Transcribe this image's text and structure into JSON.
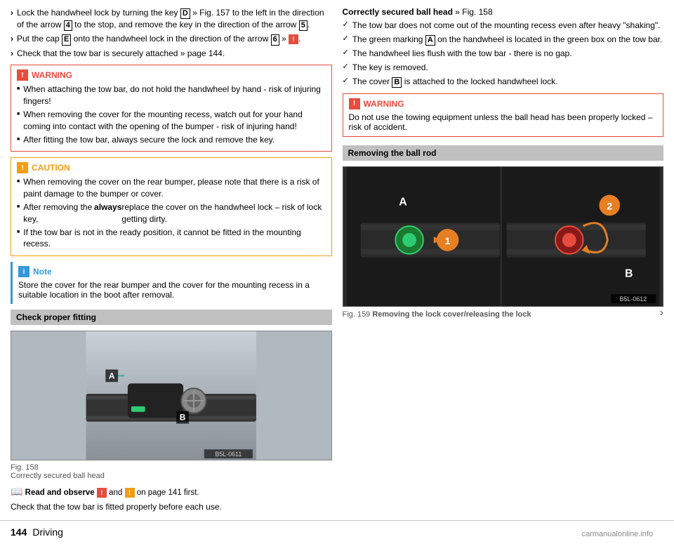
{
  "page": {
    "number": "144",
    "section": "Driving"
  },
  "left_column": {
    "intro_items": [
      {
        "id": "item1",
        "text": "Lock the handwheel lock by turning the key ",
        "key": "D",
        "mid_text": " » Fig. 157 to the left in the direction of the arrow ",
        "box2": "4",
        "end_text": " to the stop, and remove the key in the direction of the arrow ",
        "box3": "5",
        "final": "."
      },
      {
        "id": "item2",
        "text": "Put the cap ",
        "box": "E",
        "mid_text": " onto the handwheel lock in the direction of the arrow ",
        "box2": "6",
        "end_text": " » ",
        "icon": "!",
        "final": "."
      },
      {
        "id": "item3",
        "text": "Check that the tow bar is securely attached » page 144."
      }
    ],
    "warning": {
      "title": "WARNING",
      "items": [
        "When attaching the tow bar, do not hold the handwheel by hand - risk of injuring fingers!",
        "When removing the cover for the mounting recess, watch out for your hand coming into contact with the opening of the bumper - risk of injuring hand!",
        "After fitting the tow bar, always secure the lock and remove the key."
      ]
    },
    "caution": {
      "title": "CAUTION",
      "items": [
        "When removing the cover on the rear bumper, please note that there is a risk of paint damage to the bumper or cover.",
        "After removing the key, always replace the cover on the handwheel lock – risk of lock getting dirty.",
        "If the tow bar is not in the ready position, it cannot be fitted in the mounting recess."
      ]
    },
    "note": {
      "title": "Note",
      "text": "Store the cover for the rear bumper and the cover for the mounting recess in a suitable location in the boot after removal."
    },
    "check_section": {
      "header": "Check proper fitting",
      "figure": {
        "num": "Fig. 158",
        "caption": "Correctly secured ball head",
        "id": "B5L-0611",
        "label_a": "A",
        "label_b": "B"
      },
      "read_observe": "Read and observe",
      "warning_ref": "!",
      "caution_ref": "!",
      "page_ref": "on page 141 first.",
      "body_text": "Check that the tow bar is fitted properly before each use."
    }
  },
  "right_column": {
    "ball_head_section": {
      "title": "Correctly secured ball head",
      "fig_ref": "» Fig. 158",
      "check_items": [
        "The tow bar does not come out of the mounting recess even after heavy \"shaking\".",
        "The green marking ",
        "A",
        " on the handwheel is located in the green box on the tow bar.",
        "The handwheel lies flush with the tow bar - there is no gap.",
        "The key is removed.",
        "The cover "
      ],
      "items": [
        {
          "text": "The tow bar does not come out of the mounting recess even after heavy \"shaking\"."
        },
        {
          "text_parts": [
            "The green marking ",
            "A",
            " on the handwheel is located in the green box on the tow bar."
          ],
          "has_box": true,
          "box_pos": 1
        },
        {
          "text": "The handwheel lies flush with the tow bar - there is no gap."
        },
        {
          "text": "The key is removed."
        },
        {
          "text_parts": [
            "The cover ",
            "B",
            " is attached to the locked handwheel lock."
          ],
          "has_box": true,
          "box_pos": 1
        }
      ]
    },
    "warning2": {
      "title": "WARNING",
      "text": "Do not use the towing equipment unless the ball head has been properly locked – risk of accident."
    },
    "removing_section": {
      "header": "Removing the ball rod",
      "figure": {
        "caption": "Fig. 159",
        "caption_text": "Removing the lock cover/releasing the lock",
        "id": "B5L-0612",
        "label_a": "A",
        "label_b": "B",
        "num1": "1",
        "num2": "2"
      }
    }
  },
  "watermark": "carmanualonline.info"
}
